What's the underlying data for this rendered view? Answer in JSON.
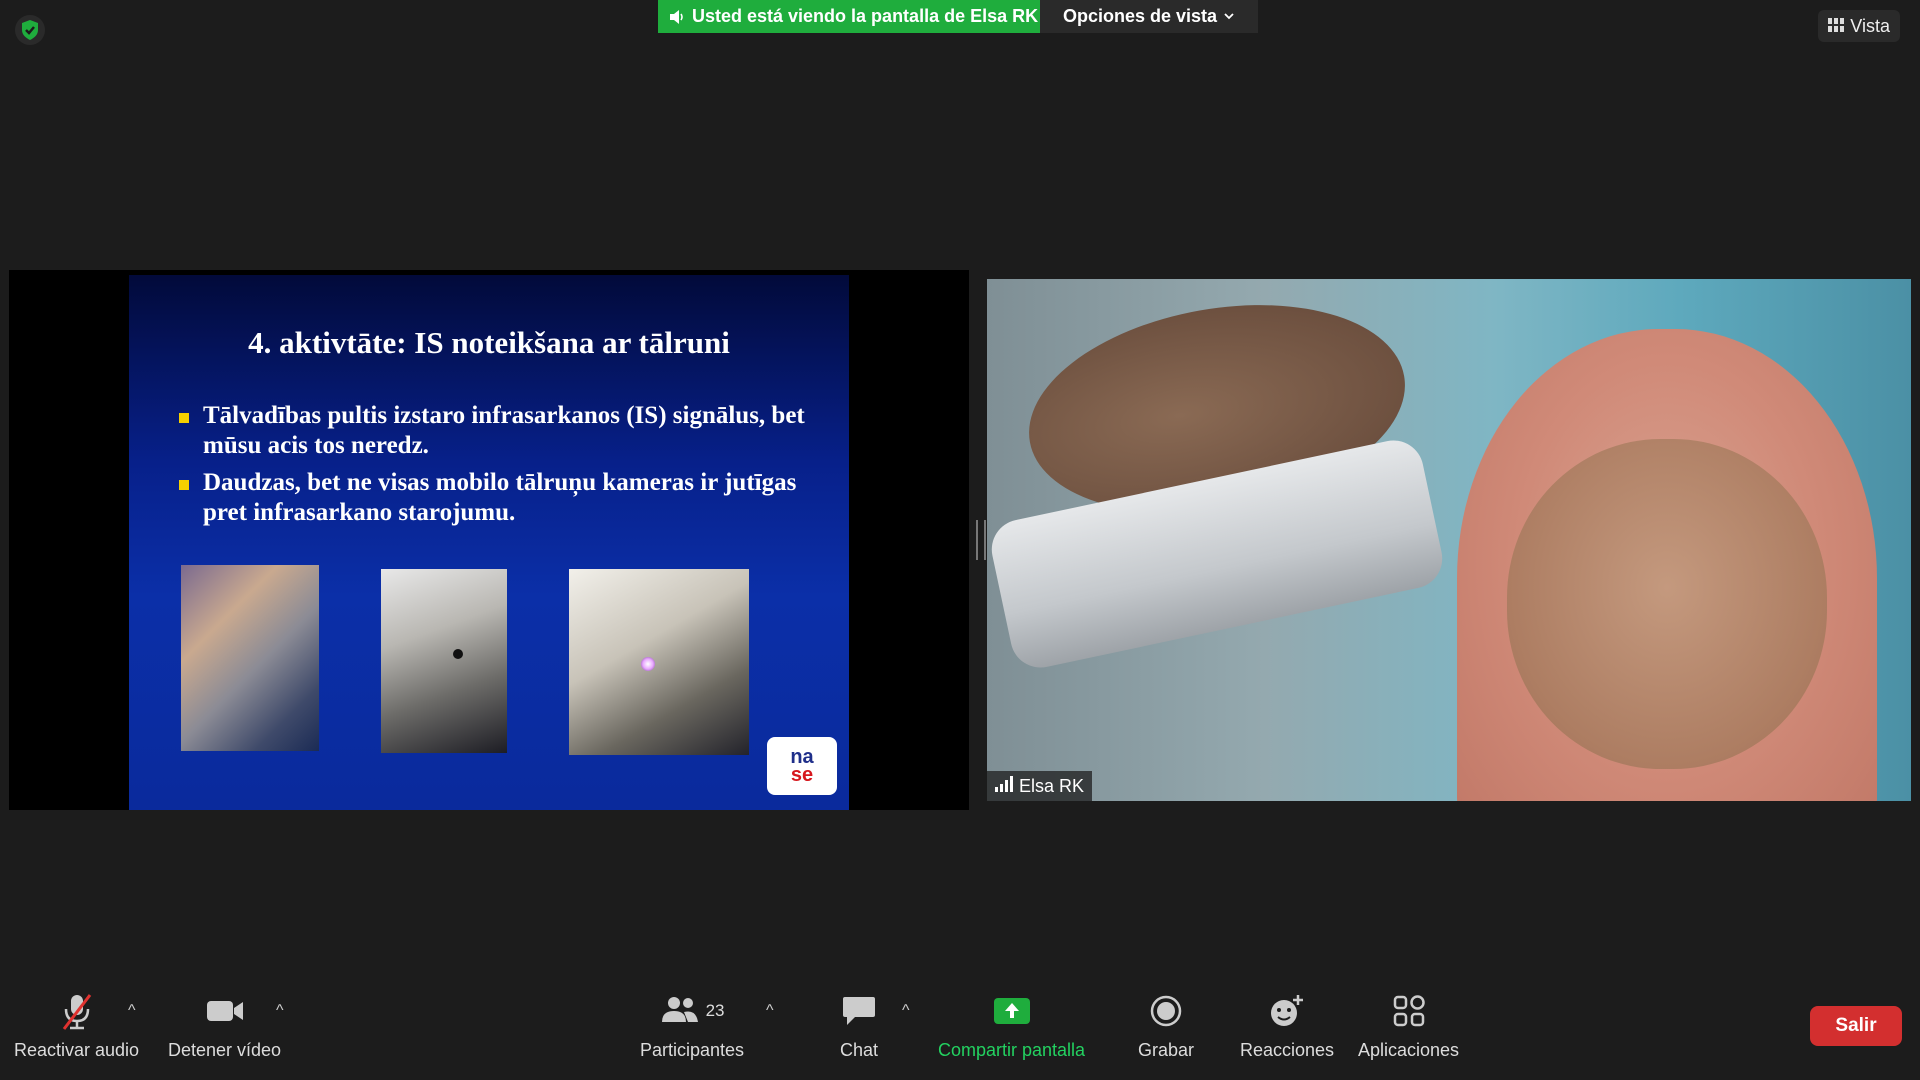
{
  "top_bar": {
    "share_banner": "Usted está viendo la pantalla de Elsa RK",
    "view_options": "Opciones de vista",
    "vista_button": "Vista"
  },
  "slide": {
    "title": "4. aktivtāte: IS noteikšana ar tālruni",
    "bullets": [
      "Tālvadības pultis izstaro infrasarkanos (IS) signālus, bet mūsu acis tos neredz.",
      "Daudzas, bet ne visas mobilo tālruņu kameras ir jutīgas pret infrasarkano starojumu."
    ],
    "logo_text_top": "na",
    "logo_text_bottom": "se"
  },
  "video": {
    "participant_name": "Elsa RK"
  },
  "toolbar": {
    "audio_label": "Reactivar audio",
    "video_label": "Detener vídeo",
    "participants_label": "Participantes",
    "participants_count": "23",
    "chat_label": "Chat",
    "share_label": "Compartir pantalla",
    "record_label": "Grabar",
    "reactions_label": "Reacciones",
    "apps_label": "Aplicaciones",
    "leave_label": "Salir"
  },
  "colors": {
    "share_green": "#1fad3d",
    "leave_red": "#d32f2f",
    "background": "#1c1c1c"
  }
}
